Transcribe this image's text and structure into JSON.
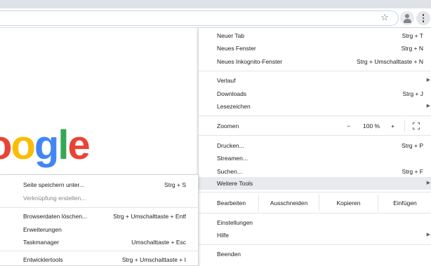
{
  "toolbar": {
    "bookmark_icon": "star-icon",
    "profile_icon": "avatar-icon",
    "menu_icon": "kebab-menu-icon"
  },
  "logo": {
    "p1": "o",
    "p2": "o",
    "p3": "g",
    "p4": "l",
    "p5": "e"
  },
  "menu": {
    "new_tab": {
      "label": "Neuer Tab",
      "shortcut": "Strg + T"
    },
    "new_window": {
      "label": "Neues Fenster",
      "shortcut": "Strg + N"
    },
    "incognito": {
      "label": "Neues Inkognito-Fenster",
      "shortcut": "Strg + Umschalttaste + N"
    },
    "history": {
      "label": "Verlauf"
    },
    "downloads": {
      "label": "Downloads",
      "shortcut": "Strg + J"
    },
    "bookmarks": {
      "label": "Lesezeichen"
    },
    "zoom": {
      "label": "Zoomen",
      "minus": "−",
      "value": "100 %",
      "plus": "+"
    },
    "print": {
      "label": "Drucken...",
      "shortcut": "Strg + P"
    },
    "cast": {
      "label": "Streamen..."
    },
    "find": {
      "label": "Suchen...",
      "shortcut": "Strg + F"
    },
    "more_tools": {
      "label": "Weitere Tools"
    },
    "edit": {
      "label": "Bearbeiten",
      "cut": "Ausschneiden",
      "copy": "Kopieren",
      "paste": "Einfügen"
    },
    "settings": {
      "label": "Einstellungen"
    },
    "help": {
      "label": "Hilfe"
    },
    "exit": {
      "label": "Beenden"
    }
  },
  "submenu": {
    "save_page": {
      "label": "Seite speichern unter...",
      "shortcut": "Strg + S"
    },
    "create_shortcut": {
      "label": "Verknüpfung erstellen..."
    },
    "clear_data": {
      "label": "Browserdaten löschen...",
      "shortcut": "Strg + Umschalttaste + Entf"
    },
    "extensions": {
      "label": "Erweiterungen"
    },
    "task_manager": {
      "label": "Taskmanager",
      "shortcut": "Umschalttaste + Esc"
    },
    "dev_tools": {
      "label": "Entwicklertools",
      "shortcut": "Strg + Umschalttaste + I"
    }
  },
  "colors": {
    "menu_highlight": "#e8eaed",
    "logo_red": "#ea4335",
    "logo_yellow": "#fbbc05",
    "logo_blue": "#4285f4",
    "logo_green": "#34a853"
  }
}
